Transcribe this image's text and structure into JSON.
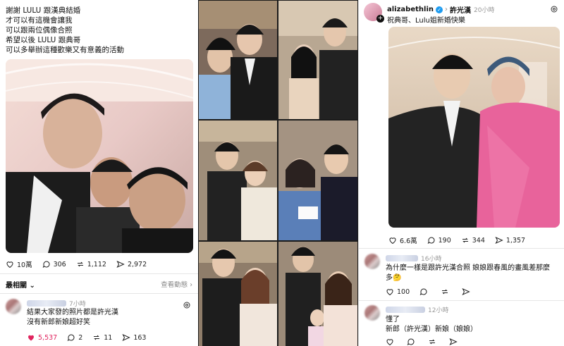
{
  "left": {
    "lines": [
      "謝謝 LULU 跟漢典結婚",
      "才可以有這機會讓我",
      "可以跟兩位偶像合照",
      "希望以後 LULU 跟典哥",
      "可以多舉辦這種歡樂又有意義的活動"
    ],
    "stats": {
      "likes": "10萬",
      "comments": "306",
      "reposts": "1,112",
      "shares": "2,972"
    },
    "sort_label": "最相關",
    "view_activity": "查看動態",
    "comment": {
      "time": "7小時",
      "lines": [
        "結果大家發的照片都是許光漢",
        "沒有新郎新娘超好笑"
      ],
      "likes": "5,537",
      "comments": "2",
      "reposts": "11",
      "shares": "163"
    }
  },
  "right": {
    "username": "alizabethlin",
    "tagged": "許光漢",
    "time": "20小時",
    "caption": "祝典哥、Lulu姐新婚快樂",
    "stats": {
      "likes": "6.6萬",
      "comments": "190",
      "reposts": "344",
      "shares": "1,357"
    },
    "comment1": {
      "time": "16小時",
      "lines": [
        "為什麼一樣是跟許光漢合照  娘娘跟春風的畫風差那麼",
        "多🤔"
      ],
      "likes": "100"
    },
    "comment2": {
      "time": "12小時",
      "lines": [
        "懂了",
        "新郎（許光漢）新娘（娘娘）"
      ]
    }
  },
  "colors": {
    "heart_red": "#e0245e",
    "verified": "#1d9bf0"
  }
}
